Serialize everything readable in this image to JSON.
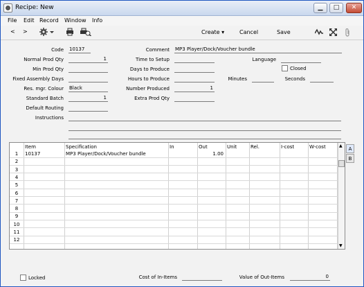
{
  "window": {
    "title": "Recipe: New"
  },
  "titlebar_buttons": {
    "minimize": "▁",
    "maximize": "□",
    "close": "✕"
  },
  "menu": [
    "File",
    "Edit",
    "Record",
    "Window",
    "Info"
  ],
  "toolbar": {
    "prev": "<",
    "next": ">",
    "create": "Create",
    "cancel": "Cancel",
    "save": "Save"
  },
  "form": {
    "code_label": "Code",
    "code": "10137",
    "normal_prod_qty_label": "Normal Prod Qty",
    "normal_prod_qty": "1",
    "min_prod_qty_label": "Min Prod Qty",
    "min_prod_qty": "",
    "fixed_assembly_days_label": "Fixed Assembly Days",
    "fixed_assembly_days": "",
    "res_mgr_colour_label": "Res. mgr. Colour",
    "res_mgr_colour": "Black",
    "standard_batch_label": "Standard Batch",
    "standard_batch": "1",
    "default_routing_label": "Default Routing",
    "default_routing": "",
    "instructions_label": "Instructions",
    "comment_label": "Comment",
    "comment": "MP3 Player/Dock/Voucher bundle",
    "time_to_setup_label": "Time to Setup",
    "time_to_setup": "",
    "days_to_produce_label": "Days to Produce",
    "days_to_produce": "",
    "hours_to_produce_label": "Hours to Produce",
    "hours_to_produce": "",
    "number_produced_label": "Number Produced",
    "number_produced": "1",
    "extra_prod_qty_label": "Extra Prod Qty",
    "extra_prod_qty": "",
    "language_label": "Language",
    "language": "",
    "closed_label": "Closed",
    "minutes_label": "Minutes",
    "minutes": "",
    "seconds_label": "Seconds",
    "seconds": ""
  },
  "grid": {
    "columns": [
      "Item",
      "Specification",
      "In",
      "Out",
      "Unit",
      "Rel.",
      "I-cost",
      "W-cost"
    ],
    "rows": [
      {
        "num": "1",
        "item": "10137",
        "spec": "MP3 Player/Dock/Voucher bundle",
        "in": "",
        "out": "1.00",
        "unit": "",
        "rel": "",
        "icost": "",
        "wcost": ""
      },
      {
        "num": "2"
      },
      {
        "num": "3"
      },
      {
        "num": "4"
      },
      {
        "num": "5"
      },
      {
        "num": "6"
      },
      {
        "num": "7"
      },
      {
        "num": "8"
      },
      {
        "num": "9"
      },
      {
        "num": "10"
      },
      {
        "num": "11"
      },
      {
        "num": "12"
      }
    ],
    "tabs": [
      "A",
      "B"
    ]
  },
  "footer": {
    "locked_label": "Locked",
    "cost_in_label": "Cost of In-Items",
    "cost_in": "",
    "value_out_label": "Value of Out-Items",
    "value_out": "0"
  },
  "colors": {
    "titlebar": "#c9d8ee",
    "close_button": "#c44b34",
    "window_border": "#1e56c0"
  }
}
